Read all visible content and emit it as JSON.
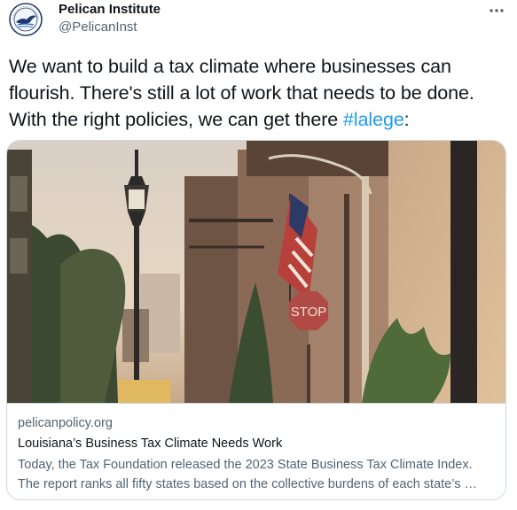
{
  "account": {
    "name": "Pelican Institute",
    "handle": "@PelicanInst",
    "avatar_icon": "pelican-logo-icon",
    "logo_text": "PELICAN INSTITUTE",
    "brand_color": "#1e3a6e"
  },
  "more_icon": "more-options-icon",
  "tweet": {
    "text_before": "We want to build a tax climate where businesses can flourish. There's still a lot of work that needs to be done. With the right policies, we can get there ",
    "hashtag": "#lalege",
    "text_after": ":"
  },
  "card": {
    "image_description_icon": "street-photo",
    "sign_text": "STOP",
    "domain": "pelicanpolicy.org",
    "title": "Louisiana’s Business Tax Climate Needs Work",
    "desc_line1": "Today, the Tax Foundation released the 2023 State Business Tax Climate Index.",
    "desc_line2": "The report ranks all fifty states based on the collective burdens of each state’s …"
  },
  "colors": {
    "text": "#0f1419",
    "secondary": "#536471",
    "link": "#1d9bf0",
    "border": "#cfd9de"
  }
}
